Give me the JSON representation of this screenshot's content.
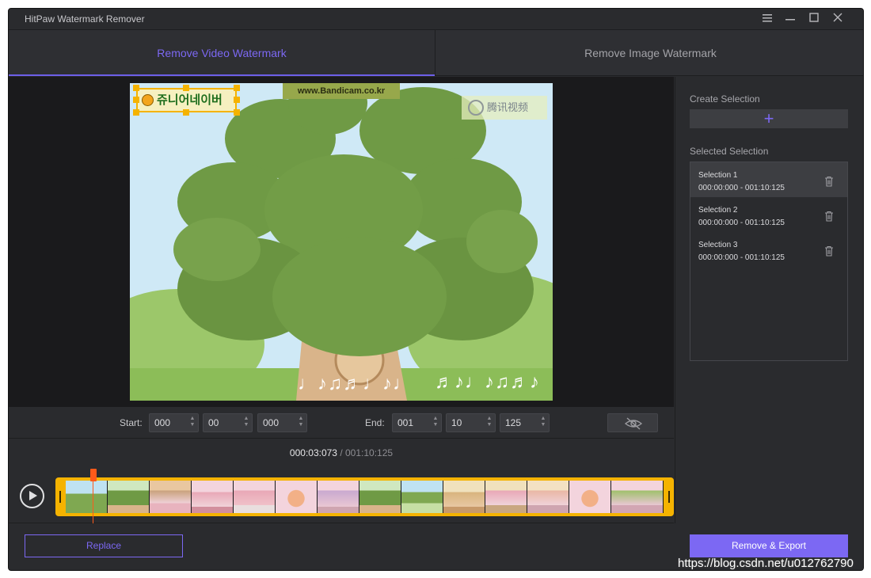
{
  "window": {
    "title": "HitPaw Watermark Remover"
  },
  "title_controls": {
    "menu_icon": "menu-icon",
    "minimize_icon": "minimize-icon",
    "maximize_icon": "maximize-icon",
    "close_icon": "close-icon"
  },
  "tabs": [
    {
      "label": "Remove Video Watermark",
      "active": true
    },
    {
      "label": "Remove Image Watermark",
      "active": false
    }
  ],
  "video": {
    "watermarks": {
      "logo_text": "쥬니어네이버",
      "bandicam_text": "www.Bandicam.co.kr",
      "tencent_text": "腾讯视频"
    },
    "notes_left": "♩♪♫♬♩♪♩",
    "notes_right": "♬♪♩♪♫♬♪"
  },
  "time_inputs": {
    "start_label": "Start:",
    "start": [
      "000",
      "00",
      "000"
    ],
    "end_label": "End:",
    "end": [
      "001",
      "10",
      "125"
    ],
    "visibility_icon": "eye-slash-icon"
  },
  "timeline": {
    "current": "000:03:073",
    "separator": " / ",
    "total": "001:10:125",
    "play_icon": "play-icon"
  },
  "panel": {
    "create_heading": "Create Selection",
    "create_icon": "plus-icon",
    "selected_heading": "Selected Selection",
    "selections": [
      {
        "name": "Selection 1",
        "range": "000:00:000 - 001:10:125",
        "active": true
      },
      {
        "name": "Selection 2",
        "range": "000:00:000 - 001:10:125",
        "active": false
      },
      {
        "name": "Selection 3",
        "range": "000:00:000 - 001:10:125",
        "active": false
      }
    ],
    "delete_icon": "trash-icon"
  },
  "buttons": {
    "replace": "Replace",
    "export": "Remove & Export"
  },
  "overlay_url": "https://blog.csdn.net/u012762790",
  "colors": {
    "accent": "#7c68f3",
    "selection": "#f5b300",
    "playhead": "#ff5a1a",
    "background": "#2a2b2e"
  }
}
